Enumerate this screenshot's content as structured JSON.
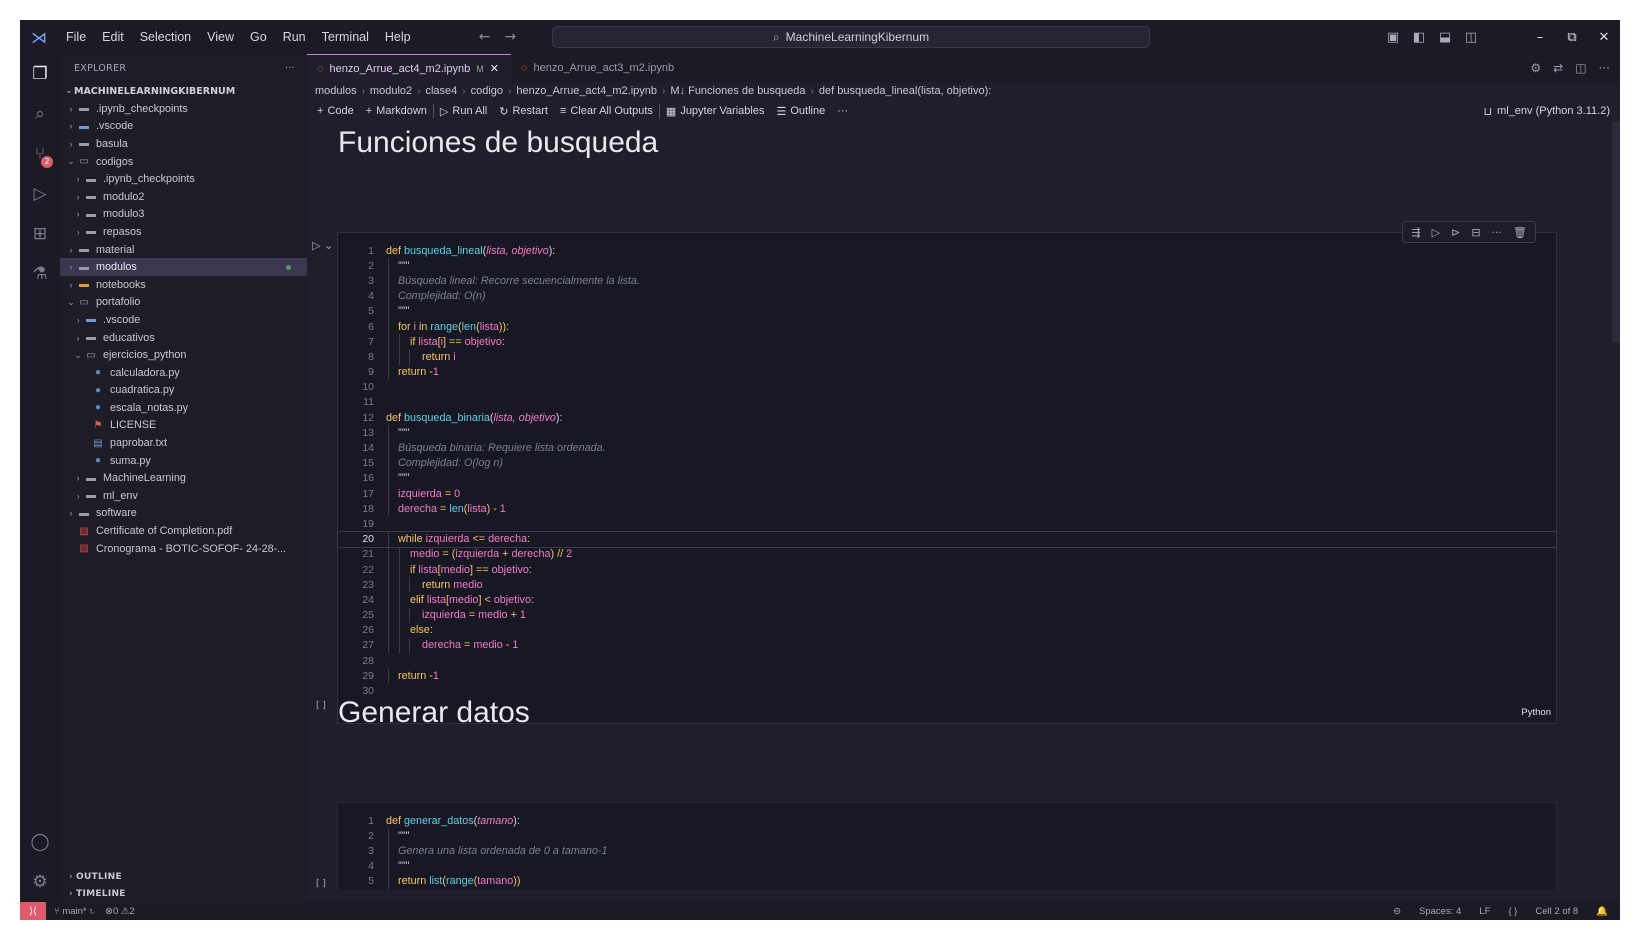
{
  "menu": [
    "File",
    "Edit",
    "Selection",
    "View",
    "Go",
    "Run",
    "Terminal",
    "Help"
  ],
  "command_center": "MachineLearningKibernum",
  "sidebar": {
    "title": "EXPLORER",
    "root": "MACHINELEARNINGKIBERNUM",
    "items": [
      {
        "label": ".ipynb_checkpoints",
        "icon": "folder",
        "depth": 1,
        "chev": ">"
      },
      {
        "label": ".vscode",
        "icon": "folder-vscode",
        "depth": 1,
        "chev": ">"
      },
      {
        "label": "basula",
        "icon": "folder",
        "depth": 1,
        "chev": ">"
      },
      {
        "label": "codigos",
        "icon": "folder-open",
        "depth": 1,
        "chev": "v"
      },
      {
        "label": ".ipynb_checkpoints",
        "icon": "folder",
        "depth": 2,
        "chev": ">"
      },
      {
        "label": "modulo2",
        "icon": "folder",
        "depth": 2,
        "chev": ">"
      },
      {
        "label": "modulo3",
        "icon": "folder",
        "depth": 2,
        "chev": ">"
      },
      {
        "label": "repasos",
        "icon": "folder",
        "depth": 2,
        "chev": ">"
      },
      {
        "label": "material",
        "icon": "folder",
        "depth": 1,
        "chev": ">"
      },
      {
        "label": "modulos",
        "icon": "folder",
        "depth": 1,
        "chev": ">",
        "selected": true
      },
      {
        "label": "notebooks",
        "icon": "folder-notebook",
        "depth": 1,
        "chev": ">"
      },
      {
        "label": "portafolio",
        "icon": "folder-open",
        "depth": 1,
        "chev": "v"
      },
      {
        "label": ".vscode",
        "icon": "folder-vscode",
        "depth": 2,
        "chev": ">"
      },
      {
        "label": "educativos",
        "icon": "folder",
        "depth": 2,
        "chev": ">"
      },
      {
        "label": "ejercicios_python",
        "icon": "folder-open",
        "depth": 2,
        "chev": "v"
      },
      {
        "label": "calculadora.py",
        "icon": "python",
        "depth": 3,
        "chev": ""
      },
      {
        "label": "cuadratica.py",
        "icon": "python",
        "depth": 3,
        "chev": ""
      },
      {
        "label": "escala_notas.py",
        "icon": "python",
        "depth": 3,
        "chev": ""
      },
      {
        "label": "LICENSE",
        "icon": "license",
        "depth": 3,
        "chev": ""
      },
      {
        "label": "paprobar.txt",
        "icon": "text",
        "depth": 3,
        "chev": ""
      },
      {
        "label": "suma.py",
        "icon": "python",
        "depth": 3,
        "chev": ""
      },
      {
        "label": "MachineLearning",
        "icon": "folder",
        "depth": 2,
        "chev": ">"
      },
      {
        "label": "ml_env",
        "icon": "folder",
        "depth": 2,
        "chev": ">"
      },
      {
        "label": "software",
        "icon": "folder",
        "depth": 1,
        "chev": ">"
      },
      {
        "label": "Certificate of Completion.pdf",
        "icon": "pdf",
        "depth": 1,
        "chev": ""
      },
      {
        "label": "Cronograma - BOTIC-SOFOF- 24-28-...",
        "icon": "pdf",
        "depth": 1,
        "chev": ""
      }
    ],
    "outline": "OUTLINE",
    "timeline": "TIMELINE"
  },
  "tabs": [
    {
      "label": "henzo_Arrue_act4_m2.ipynb",
      "modified": "M",
      "active": true
    },
    {
      "label": "henzo_Arrue_act3_m2.ipynb",
      "active": false
    }
  ],
  "breadcrumb": [
    "modulos",
    "modulo2",
    "clase4",
    "codigo",
    "henzo_Arrue_act4_m2.ipynb",
    "M↓ Funciones de busqueda",
    "def busqueda_lineal(lista, objetivo):"
  ],
  "toolbar": {
    "code": "Code",
    "markdown": "Markdown",
    "run_all": "Run All",
    "restart": "Restart",
    "clear": "Clear All Outputs",
    "variables": "Jupyter Variables",
    "outline": "Outline",
    "more": "···",
    "kernel": "ml_env (Python 3.11.2)"
  },
  "notebook": {
    "h1": "Funciones de busqueda",
    "h2": "Generar datos",
    "cell_lang": "Python",
    "exec_count": "[ ]",
    "code1": [
      "def busqueda_lineal(lista, objetivo):",
      "    \"\"\"",
      "    Búsqueda lineal: Recorre secuencialmente la lista.",
      "    Complejidad: O(n)",
      "    \"\"\"",
      "    for i in range(len(lista)):",
      "        if lista[i] == objetivo:",
      "            return i",
      "    return -1",
      "",
      "",
      "def busqueda_binaria(lista, objetivo):",
      "    \"\"\"",
      "    Búsqueda binaria: Requiere lista ordenada.",
      "    Complejidad: O(log n)",
      "    \"\"\"",
      "    izquierda = 0",
      "    derecha = len(lista) - 1",
      "",
      "    while izquierda <= derecha:",
      "        medio = (izquierda + derecha) // 2",
      "        if lista[medio] == objetivo:",
      "            return medio",
      "        elif lista[medio] < objetivo:",
      "            izquierda = medio + 1",
      "        else:",
      "            derecha = medio - 1",
      "",
      "    return -1",
      ""
    ],
    "code2": [
      "def generar_datos(tamano):",
      "    \"\"\"",
      "    Genera una lista ordenada de 0 a tamano-1",
      "    \"\"\"",
      "    return list(range(tamano))"
    ]
  },
  "status": {
    "branch": "main*",
    "problems": "0",
    "warnings": "2",
    "spaces": "Spaces: 4",
    "eol": "LF",
    "braces": "{ }",
    "cell": "Cell 2 of 8"
  }
}
